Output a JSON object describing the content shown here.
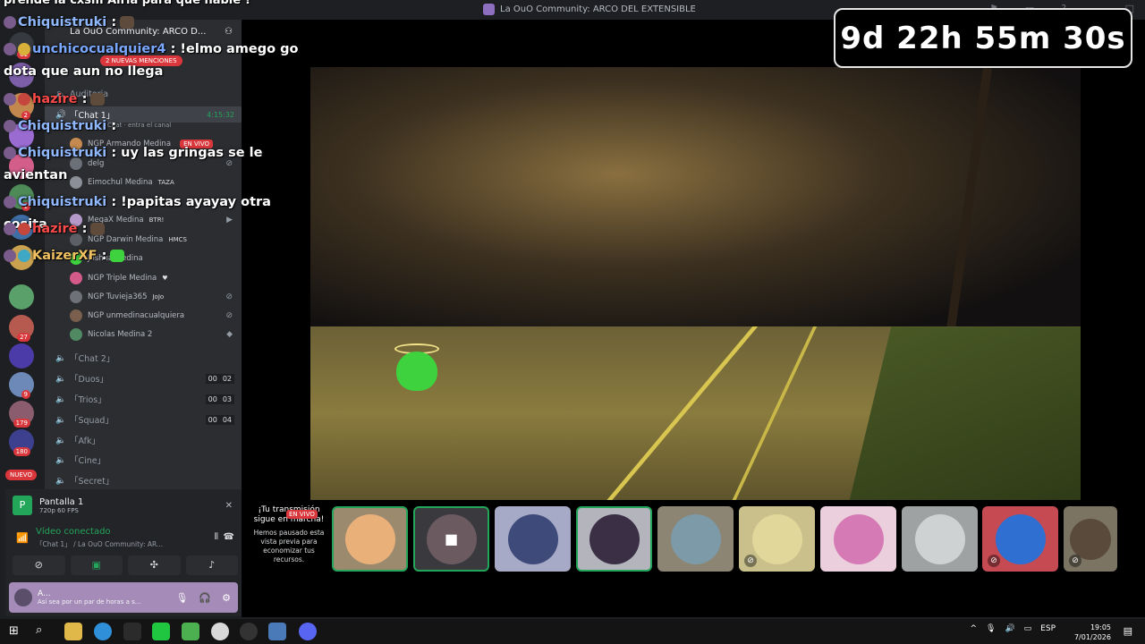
{
  "window": {
    "title": "La OuO Community: ARCO DEL EXTENSIBLE"
  },
  "guild": {
    "name": "La OuO Community: ARCO D...",
    "mentions_pill": "2 NUEVAS MENCIONES",
    "nuevo_badge": "NUEVO"
  },
  "rail_badges": [
    "61",
    "2",
    "1",
    "27",
    "9",
    "179",
    "180"
  ],
  "channels": [
    {
      "name": "Auditoria",
      "icon": "speaker-icon"
    },
    {
      "name": "「Chat 1」",
      "icon": "speaker-icon",
      "time": "4:15:32",
      "sub": "Chat · entra el canal"
    },
    {
      "name": "「Chat 2」",
      "icon": "speaker-icon"
    },
    {
      "name": "「Duos」",
      "icon": "speaker-icon",
      "counts": [
        "00",
        "02"
      ]
    },
    {
      "name": "「Trios」",
      "icon": "speaker-icon",
      "counts": [
        "00",
        "03"
      ]
    },
    {
      "name": "「Squad」",
      "icon": "speaker-icon",
      "counts": [
        "00",
        "04"
      ]
    },
    {
      "name": "「Afk」",
      "icon": "speaker-icon"
    },
    {
      "name": "「Cine」",
      "icon": "speaker-icon"
    },
    {
      "name": "「Secret」",
      "icon": "speaker-icon"
    }
  ],
  "members": [
    {
      "name": "NGP Armando Medina",
      "live": "EN VIVO"
    },
    {
      "name": "delg"
    },
    {
      "name": "Eimochul Medina",
      "tag": "TAZA"
    },
    {
      "name": "MegaX Medina",
      "tag": "BTR!"
    },
    {
      "name": "NGP Darwin Medina",
      "tag": "HMCS"
    },
    {
      "name": "Joshua Medina"
    },
    {
      "name": "NGP Triple Medina",
      "tag": "♥"
    },
    {
      "name": "NGP Tuvieja365",
      "tag": "JoJo"
    },
    {
      "name": "NGP unmedinacualquiera"
    },
    {
      "name": "Nicolas Medina 2"
    }
  ],
  "screen_share": {
    "name": "Pantalla 1",
    "quality": "720p 60 FPS"
  },
  "voice": {
    "status": "Vídeo conectado",
    "channel": "「Chat 1」 / La OuO Community: AR..."
  },
  "user": {
    "name": "A...",
    "status": "Así sea por un par de horas a s..."
  },
  "timer": "9d 22h 55m 30s",
  "paused": {
    "headline": "¡Tu transmisión sigue en marcha!",
    "live": "EN VIVO",
    "body": "Hemos pausado esta vista previa para economizar tus recursos."
  },
  "chat": {
    "top": "prende la cxsm Airia para que hable ?",
    "messages": [
      {
        "user": "Chiquistruki",
        "text": ":",
        "color": "#8fb8ff"
      },
      {
        "user": "unchicocualquier4",
        "text": ": !elmo amego go dota que aun no llega",
        "color": "#7aa7ff"
      },
      {
        "user": "hazire",
        "text": ":",
        "color": "#ff4a4a"
      },
      {
        "user": "Chiquistruki",
        "text": ":",
        "color": "#8fb8ff"
      },
      {
        "user": "Chiquistruki",
        "text": ": uy las gringas se le avientan",
        "color": "#8fb8ff"
      },
      {
        "user": "Chiquistruki",
        "text": ": !papitas ayayay otra cosita",
        "color": "#8fb8ff"
      },
      {
        "user": "hazire",
        "text": ":",
        "color": "#ff4a4a"
      },
      {
        "user": "KaizerXF",
        "text": ":",
        "color": "#f0c060"
      }
    ]
  },
  "taskbar": {
    "lang": "ESP",
    "time": "19:05",
    "date": "7/01/2026"
  }
}
